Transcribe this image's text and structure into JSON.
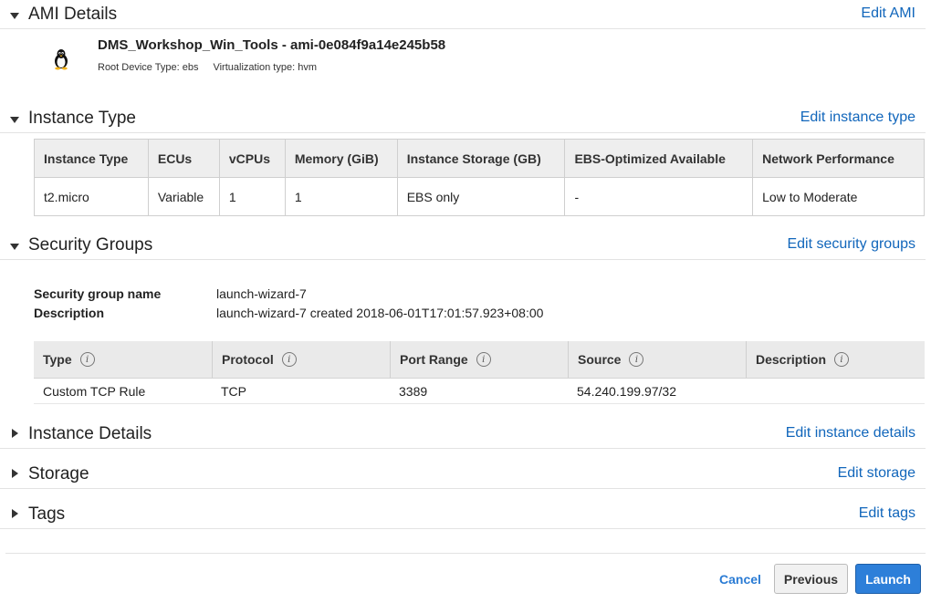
{
  "ami": {
    "section_title": "AMI Details",
    "edit_label": "Edit AMI",
    "name": "DMS_Workshop_Win_Tools - ami-0e084f9a14e245b58",
    "root_device": "Root Device Type: ebs",
    "virtualization": "Virtualization type: hvm",
    "icon": "linux-penguin-icon"
  },
  "instance_type": {
    "section_title": "Instance Type",
    "edit_label": "Edit instance type",
    "columns": [
      "Instance Type",
      "ECUs",
      "vCPUs",
      "Memory (GiB)",
      "Instance Storage (GB)",
      "EBS-Optimized Available",
      "Network Performance"
    ],
    "row": [
      "t2.micro",
      "Variable",
      "1",
      "1",
      "EBS only",
      "-",
      "Low to Moderate"
    ]
  },
  "security_groups": {
    "section_title": "Security Groups",
    "edit_label": "Edit security groups",
    "name_label": "Security group name",
    "name_value": "launch-wizard-7",
    "desc_label": "Description",
    "desc_value": "launch-wizard-7 created 2018-06-01T17:01:57.923+08:00",
    "columns": [
      "Type",
      "Protocol",
      "Port Range",
      "Source",
      "Description"
    ],
    "rows": [
      [
        "Custom TCP Rule",
        "TCP",
        "3389",
        "54.240.199.97/32",
        ""
      ]
    ]
  },
  "instance_details": {
    "section_title": "Instance Details",
    "edit_label": "Edit instance details"
  },
  "storage": {
    "section_title": "Storage",
    "edit_label": "Edit storage"
  },
  "tags": {
    "section_title": "Tags",
    "edit_label": "Edit tags"
  },
  "footer": {
    "cancel_label": "Cancel",
    "previous_label": "Previous",
    "launch_label": "Launch"
  },
  "colors": {
    "link": "#1166bb",
    "primary_button": "#2d7fd9"
  }
}
